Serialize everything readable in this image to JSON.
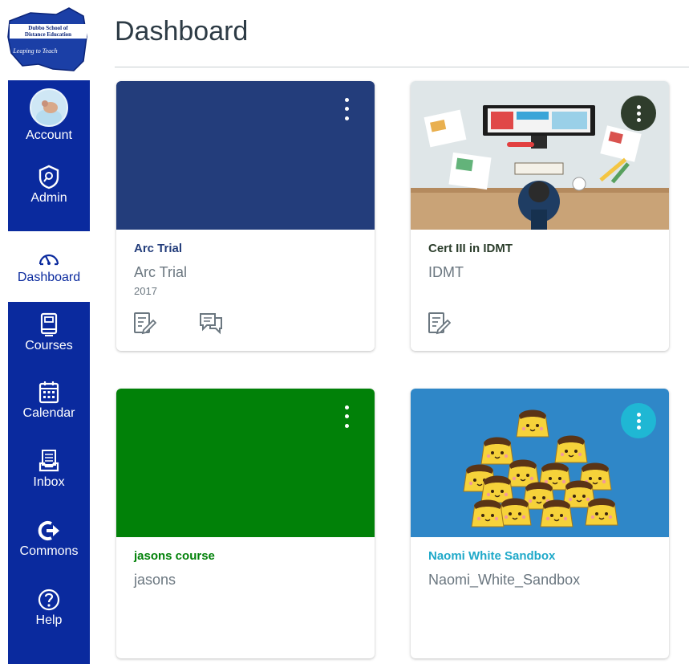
{
  "logo": {
    "line1": "Dubbo School of",
    "line2": "Distance Education",
    "tagline": "Leaping to Teach"
  },
  "page": {
    "title": "Dashboard"
  },
  "nav": {
    "items": [
      {
        "label": "Account",
        "icon": "avatar"
      },
      {
        "label": "Admin",
        "icon": "shield-icon"
      },
      {
        "label": "Dashboard",
        "icon": "speedometer-icon",
        "active": true
      },
      {
        "label": "Courses",
        "icon": "book-icon"
      },
      {
        "label": "Calendar",
        "icon": "calendar-icon"
      },
      {
        "label": "Inbox",
        "icon": "inbox-icon"
      },
      {
        "label": "Commons",
        "icon": "commons-arrow-icon"
      },
      {
        "label": "Help",
        "icon": "help-icon"
      }
    ]
  },
  "colors": {
    "nav_bg": "#0a2a9e",
    "arc_trial": "#233d7b",
    "cert_iii": "#2c3e2c",
    "jasons": "#018108",
    "naomi": "#1fa9c9"
  },
  "cards": [
    {
      "title": "Arc Trial",
      "subtitle": "Arc Trial",
      "term": "2017",
      "hero": "solid-navy",
      "icons": [
        "assignments-icon",
        "discussions-icon"
      ]
    },
    {
      "title": "Cert III in IDMT",
      "subtitle": "IDMT",
      "term": "",
      "hero": "desk-illustration",
      "icons": [
        "assignments-icon"
      ]
    },
    {
      "title": "jasons course",
      "subtitle": "jasons",
      "term": "",
      "hero": "solid-green",
      "icons": []
    },
    {
      "title": "Naomi White Sandbox",
      "subtitle": "Naomi_White_Sandbox",
      "term": "",
      "hero": "pudding-illustration",
      "icons": []
    }
  ]
}
